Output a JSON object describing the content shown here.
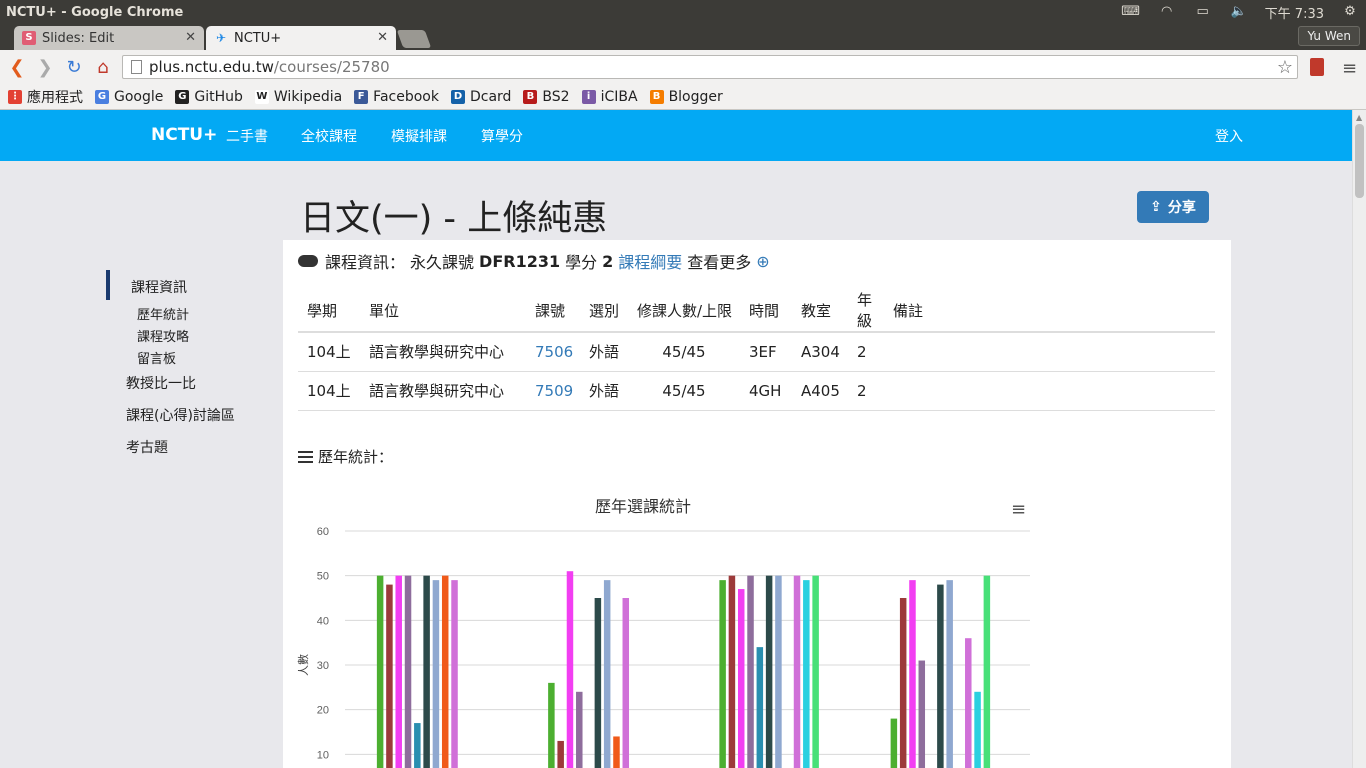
{
  "os": {
    "window_title": "NCTU+ - Google Chrome",
    "clock": "下午 7:33"
  },
  "browser": {
    "tabs": [
      {
        "label": "Slides: Edit",
        "favicon": "S"
      },
      {
        "label": "NCTU+"
      }
    ],
    "profile": "Yu Wen",
    "url_host": "plus.nctu.edu.tw",
    "url_path": "/courses/25780",
    "bookmarks": [
      {
        "label": "應用程式",
        "icon": "apps-grid-icon",
        "color": "#e34133"
      },
      {
        "label": "Google",
        "icon": "google-icon",
        "color": "#4a7fe0"
      },
      {
        "label": "GitHub",
        "icon": "github-icon",
        "color": "#222222"
      },
      {
        "label": "Wikipedia",
        "icon": "wikipedia-icon",
        "color": "#ffffff"
      },
      {
        "label": "Facebook",
        "icon": "facebook-icon",
        "color": "#3b5998"
      },
      {
        "label": "Dcard",
        "icon": "dcard-icon",
        "color": "#1461a8"
      },
      {
        "label": "BS2",
        "icon": "bs2-icon",
        "color": "#b71c1c"
      },
      {
        "label": "iCIBA",
        "icon": "iciba-icon",
        "color": "#7b5aa6"
      },
      {
        "label": "Blogger",
        "icon": "blogger-icon",
        "color": "#f57d00"
      }
    ]
  },
  "site": {
    "brand": "NCTU+",
    "nav": [
      "二手書",
      "全校課程",
      "模擬排課",
      "算學分"
    ],
    "login": "登入",
    "accent": "#03a9f4"
  },
  "page": {
    "title": "日文(一) - 上條純惠",
    "share_label": "分享"
  },
  "sidebar": {
    "items": [
      {
        "label": "課程資訊",
        "active": true
      },
      {
        "label": "歷年統計",
        "sub": true
      },
      {
        "label": "課程攻略",
        "sub": true
      },
      {
        "label": "留言板",
        "sub": true
      },
      {
        "label": "教授比一比"
      },
      {
        "label": "課程(心得)討論區"
      },
      {
        "label": "考古題"
      }
    ]
  },
  "info": {
    "label": "課程資訊：",
    "perm_label": "永久課號",
    "perm_id": "DFR1231",
    "credit_label": "學分",
    "credit": "2",
    "syllabus": "課程綱要",
    "more": "查看更多"
  },
  "table": {
    "headers": [
      "學期",
      "單位",
      "課號",
      "選別",
      "修課人數/上限",
      "時間",
      "教室",
      "年級",
      "備註"
    ],
    "rows": [
      [
        "104上",
        "語言教學與研究中心",
        "7506",
        "外語",
        "45/45",
        "3EF",
        "A304",
        "2",
        ""
      ],
      [
        "104上",
        "語言教學與研究中心",
        "7509",
        "外語",
        "45/45",
        "4GH",
        "A405",
        "2",
        ""
      ]
    ]
  },
  "stats": {
    "label": "歷年統計："
  },
  "chart_data": {
    "type": "bar",
    "title": "歷年選課統計",
    "ylabel": "人數",
    "ylim": [
      0,
      60
    ],
    "yticks": [
      10,
      20,
      30,
      40,
      50,
      60
    ],
    "groups": 4,
    "series": [
      {
        "color": "#4caf30",
        "values": [
          50,
          26,
          49,
          18
        ]
      },
      {
        "color": "#9c3a3a",
        "values": [
          48,
          13,
          50,
          45
        ]
      },
      {
        "color": "#f23ef2",
        "values": [
          50,
          51,
          47,
          49
        ]
      },
      {
        "color": "#8e6d9c",
        "values": [
          50,
          24,
          50,
          31
        ]
      },
      {
        "color": "#2a8fb0",
        "values": [
          17,
          0,
          34,
          0
        ]
      },
      {
        "color": "#2c4a4a",
        "values": [
          50,
          45,
          50,
          48
        ]
      },
      {
        "color": "#8fa8d0",
        "values": [
          49,
          49,
          50,
          49
        ]
      },
      {
        "color": "#f05a1a",
        "values": [
          50,
          14,
          0,
          0
        ]
      },
      {
        "color": "#d070d8",
        "values": [
          49,
          45,
          50,
          36
        ]
      },
      {
        "color": "#2ad0e0",
        "values": [
          0,
          0,
          49,
          24
        ]
      },
      {
        "color": "#48e078",
        "values": [
          0,
          0,
          50,
          50
        ]
      }
    ]
  }
}
